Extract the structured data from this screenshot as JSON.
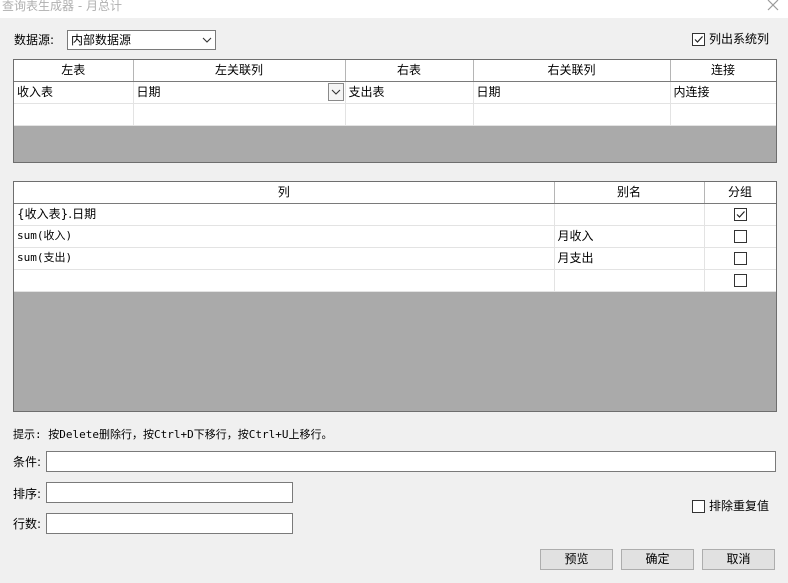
{
  "window": {
    "title": "查询表生成器 - 月总计"
  },
  "datasource": {
    "label": "数据源:",
    "selected": "内部数据源"
  },
  "list_system_columns": {
    "label": "列出系统列",
    "checked": true
  },
  "join_grid": {
    "headers": [
      "左表",
      "左关联列",
      "右表",
      "右关联列",
      "连接"
    ],
    "rows": [
      [
        "收入表",
        "日期",
        "支出表",
        "日期",
        "内连接"
      ],
      [
        "",
        "",
        "",
        "",
        ""
      ]
    ]
  },
  "column_grid": {
    "headers": [
      "列",
      "别名",
      "分组"
    ],
    "rows": [
      {
        "column": "{收入表}.日期",
        "alias": "",
        "group": true
      },
      {
        "column": "sum(收入)",
        "alias": "月收入",
        "group": false
      },
      {
        "column": "sum(支出)",
        "alias": "月支出",
        "group": false
      },
      {
        "column": "",
        "alias": "",
        "group": false
      }
    ]
  },
  "hint": "提示: 按Delete删除行，按Ctrl+D下移行，按Ctrl+U上移行。",
  "condition": {
    "label": "条件:",
    "value": ""
  },
  "sort": {
    "label": "排序:",
    "value": ""
  },
  "row_count": {
    "label": "行数:",
    "value": ""
  },
  "distinct": {
    "label": "排除重复值",
    "checked": false
  },
  "buttons": {
    "preview": "预览",
    "ok": "确定",
    "cancel": "取消"
  },
  "icons": {
    "close": "close-icon",
    "chevron": "chevron-down-icon",
    "check": "checkmark-icon"
  }
}
